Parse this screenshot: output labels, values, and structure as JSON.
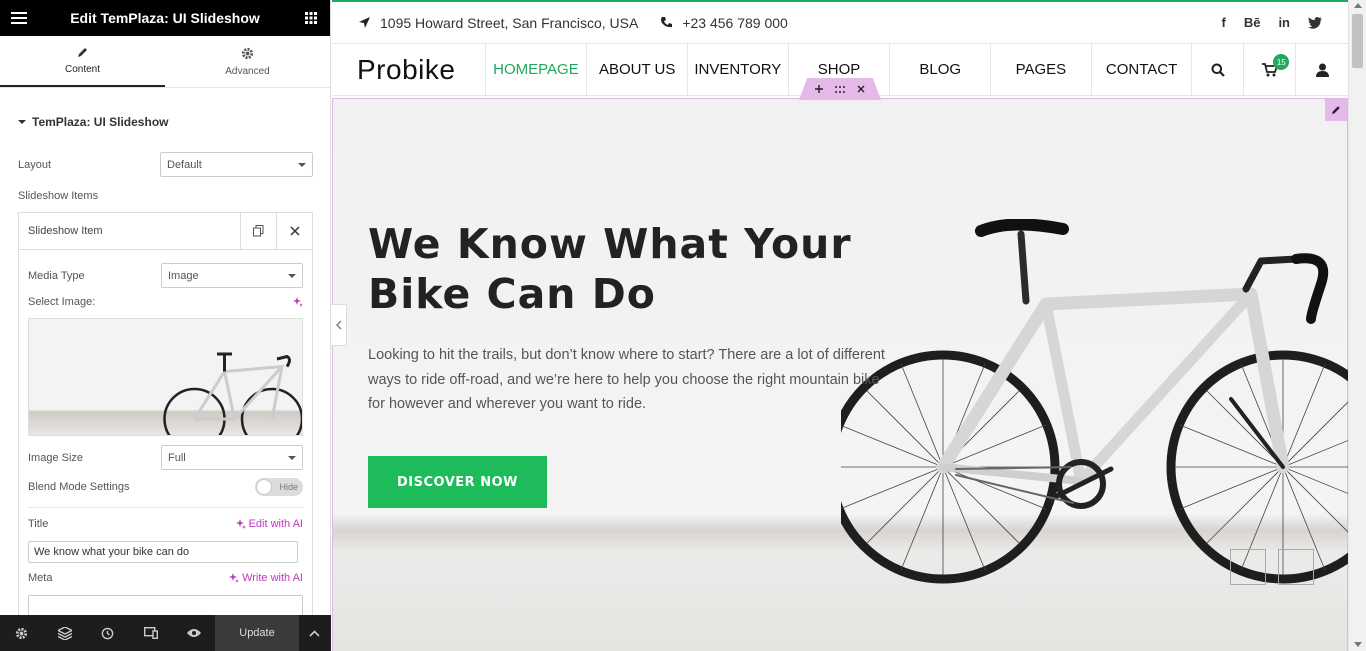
{
  "panel": {
    "title": "Edit TemPlaza: UI Slideshow",
    "tabs": [
      {
        "label": "Content"
      },
      {
        "label": "Advanced"
      }
    ],
    "section_title": "TemPlaza: UI Slideshow",
    "layout_label": "Layout",
    "layout_value": "Default",
    "items_label": "Slideshow Items",
    "item": {
      "title": "Slideshow Item",
      "media_type_label": "Media Type",
      "media_type_value": "Image",
      "select_image_label": "Select Image:",
      "image_size_label": "Image Size",
      "image_size_value": "Full",
      "blend_label": "Blend Mode Settings",
      "blend_toggle": "Hide",
      "title_label": "Title",
      "edit_ai": "Edit with AI",
      "title_value": "We know what your bike can do",
      "meta_label": "Meta",
      "write_ai": "Write with AI"
    },
    "footer": {
      "update_label": "Update"
    }
  },
  "site": {
    "topbar": {
      "address": "1095 Howard Street, San Francisco, USA",
      "phone": "+23 456 789 000",
      "social": [
        "f",
        "Bē",
        "in",
        "t"
      ]
    },
    "logo": "Probike",
    "nav": [
      "HOMEPAGE",
      "ABOUT US",
      "INVENTORY",
      "SHOP",
      "BLOG",
      "PAGES",
      "CONTACT"
    ],
    "cart_count": "15",
    "hero": {
      "title": "We Know What Your Bike Can Do",
      "text": "Looking to hit the trails, but don’t know where to start? There are a lot of different ways to ride off-road, and we’re here to help you choose the right mountain bike for however and wherever you want to ride.",
      "button": "DISCOVER NOW"
    }
  },
  "colors": {
    "accent": "#1ea95d",
    "button": "#1dbb5a",
    "elementor_pink": "#c036c3"
  }
}
